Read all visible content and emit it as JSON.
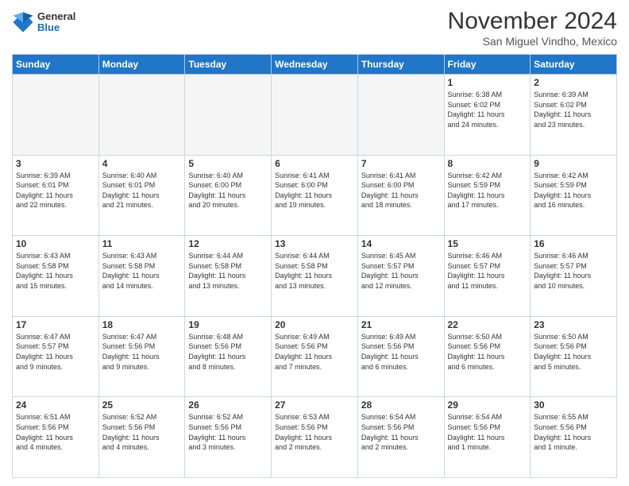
{
  "logo": {
    "general": "General",
    "blue": "Blue"
  },
  "header": {
    "title": "November 2024",
    "location": "San Miguel Vindho, Mexico"
  },
  "days": [
    "Sunday",
    "Monday",
    "Tuesday",
    "Wednesday",
    "Thursday",
    "Friday",
    "Saturday"
  ],
  "weeks": [
    [
      {
        "day": "",
        "content": ""
      },
      {
        "day": "",
        "content": ""
      },
      {
        "day": "",
        "content": ""
      },
      {
        "day": "",
        "content": ""
      },
      {
        "day": "",
        "content": ""
      },
      {
        "day": "1",
        "content": "Sunrise: 6:38 AM\nSunset: 6:02 PM\nDaylight: 11 hours\nand 24 minutes."
      },
      {
        "day": "2",
        "content": "Sunrise: 6:39 AM\nSunset: 6:02 PM\nDaylight: 11 hours\nand 23 minutes."
      }
    ],
    [
      {
        "day": "3",
        "content": "Sunrise: 6:39 AM\nSunset: 6:01 PM\nDaylight: 11 hours\nand 22 minutes."
      },
      {
        "day": "4",
        "content": "Sunrise: 6:40 AM\nSunset: 6:01 PM\nDaylight: 11 hours\nand 21 minutes."
      },
      {
        "day": "5",
        "content": "Sunrise: 6:40 AM\nSunset: 6:00 PM\nDaylight: 11 hours\nand 20 minutes."
      },
      {
        "day": "6",
        "content": "Sunrise: 6:41 AM\nSunset: 6:00 PM\nDaylight: 11 hours\nand 19 minutes."
      },
      {
        "day": "7",
        "content": "Sunrise: 6:41 AM\nSunset: 6:00 PM\nDaylight: 11 hours\nand 18 minutes."
      },
      {
        "day": "8",
        "content": "Sunrise: 6:42 AM\nSunset: 5:59 PM\nDaylight: 11 hours\nand 17 minutes."
      },
      {
        "day": "9",
        "content": "Sunrise: 6:42 AM\nSunset: 5:59 PM\nDaylight: 11 hours\nand 16 minutes."
      }
    ],
    [
      {
        "day": "10",
        "content": "Sunrise: 6:43 AM\nSunset: 5:58 PM\nDaylight: 11 hours\nand 15 minutes."
      },
      {
        "day": "11",
        "content": "Sunrise: 6:43 AM\nSunset: 5:58 PM\nDaylight: 11 hours\nand 14 minutes."
      },
      {
        "day": "12",
        "content": "Sunrise: 6:44 AM\nSunset: 5:58 PM\nDaylight: 11 hours\nand 13 minutes."
      },
      {
        "day": "13",
        "content": "Sunrise: 6:44 AM\nSunset: 5:58 PM\nDaylight: 11 hours\nand 13 minutes."
      },
      {
        "day": "14",
        "content": "Sunrise: 6:45 AM\nSunset: 5:57 PM\nDaylight: 11 hours\nand 12 minutes."
      },
      {
        "day": "15",
        "content": "Sunrise: 6:46 AM\nSunset: 5:57 PM\nDaylight: 11 hours\nand 11 minutes."
      },
      {
        "day": "16",
        "content": "Sunrise: 6:46 AM\nSunset: 5:57 PM\nDaylight: 11 hours\nand 10 minutes."
      }
    ],
    [
      {
        "day": "17",
        "content": "Sunrise: 6:47 AM\nSunset: 5:57 PM\nDaylight: 11 hours\nand 9 minutes."
      },
      {
        "day": "18",
        "content": "Sunrise: 6:47 AM\nSunset: 5:56 PM\nDaylight: 11 hours\nand 9 minutes."
      },
      {
        "day": "19",
        "content": "Sunrise: 6:48 AM\nSunset: 5:56 PM\nDaylight: 11 hours\nand 8 minutes."
      },
      {
        "day": "20",
        "content": "Sunrise: 6:49 AM\nSunset: 5:56 PM\nDaylight: 11 hours\nand 7 minutes."
      },
      {
        "day": "21",
        "content": "Sunrise: 6:49 AM\nSunset: 5:56 PM\nDaylight: 11 hours\nand 6 minutes."
      },
      {
        "day": "22",
        "content": "Sunrise: 6:50 AM\nSunset: 5:56 PM\nDaylight: 11 hours\nand 6 minutes."
      },
      {
        "day": "23",
        "content": "Sunrise: 6:50 AM\nSunset: 5:56 PM\nDaylight: 11 hours\nand 5 minutes."
      }
    ],
    [
      {
        "day": "24",
        "content": "Sunrise: 6:51 AM\nSunset: 5:56 PM\nDaylight: 11 hours\nand 4 minutes."
      },
      {
        "day": "25",
        "content": "Sunrise: 6:52 AM\nSunset: 5:56 PM\nDaylight: 11 hours\nand 4 minutes."
      },
      {
        "day": "26",
        "content": "Sunrise: 6:52 AM\nSunset: 5:56 PM\nDaylight: 11 hours\nand 3 minutes."
      },
      {
        "day": "27",
        "content": "Sunrise: 6:53 AM\nSunset: 5:56 PM\nDaylight: 11 hours\nand 2 minutes."
      },
      {
        "day": "28",
        "content": "Sunrise: 6:54 AM\nSunset: 5:56 PM\nDaylight: 11 hours\nand 2 minutes."
      },
      {
        "day": "29",
        "content": "Sunrise: 6:54 AM\nSunset: 5:56 PM\nDaylight: 11 hours\nand 1 minute."
      },
      {
        "day": "30",
        "content": "Sunrise: 6:55 AM\nSunset: 5:56 PM\nDaylight: 11 hours\nand 1 minute."
      }
    ]
  ]
}
